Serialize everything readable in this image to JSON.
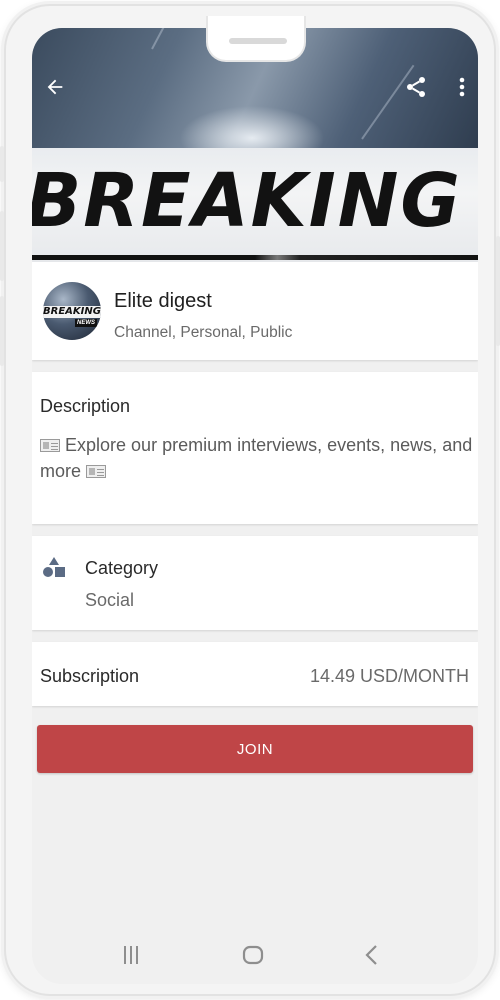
{
  "header": {
    "back_icon": "arrow-left-icon",
    "share_icon": "share-icon",
    "menu_icon": "more-vertical-icon",
    "banner_text": "BREAKING"
  },
  "channel": {
    "avatar_text": "BREAKING",
    "avatar_subtext": "NEWS",
    "name": "Elite digest",
    "meta": "Channel, Personal, Public"
  },
  "description": {
    "title": "Description",
    "line1": "Explore our premium interviews, events, news,",
    "line2": "and more",
    "icon": "newspaper-icon"
  },
  "category": {
    "icon": "shapes-icon",
    "label": "Category",
    "value": "Social"
  },
  "subscription": {
    "label": "Subscription",
    "price": "14.49 USD/MONTH"
  },
  "actions": {
    "join_label": "JOIN"
  },
  "system_nav": {
    "recents_icon": "recents-icon",
    "home_icon": "home-icon",
    "back_icon": "chevron-left-icon"
  },
  "colors": {
    "join_button": "#bf4547",
    "icon_accent": "#5b6b84"
  }
}
